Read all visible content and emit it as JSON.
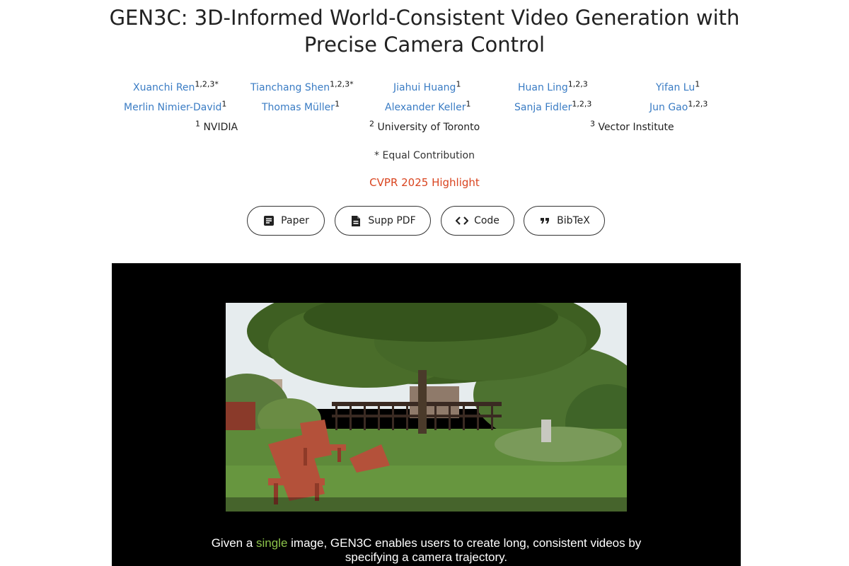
{
  "title_line1": "GEN3C: 3D-Informed World-Consistent Video Generation with",
  "title_line2": "Precise Camera Control",
  "authors": [
    {
      "name": "Xuanchi Ren",
      "sup": "1,2,3*"
    },
    {
      "name": "Tianchang Shen",
      "sup": "1,2,3*"
    },
    {
      "name": "Jiahui Huang",
      "sup": "1"
    },
    {
      "name": "Huan Ling",
      "sup": "1,2,3"
    },
    {
      "name": "Yifan Lu",
      "sup": "1"
    },
    {
      "name": "Merlin Nimier-David",
      "sup": "1"
    },
    {
      "name": "Thomas Müller",
      "sup": "1"
    },
    {
      "name": "Alexander Keller",
      "sup": "1"
    },
    {
      "name": "Sanja Fidler",
      "sup": "1,2,3"
    },
    {
      "name": "Jun Gao",
      "sup": "1,2,3"
    }
  ],
  "affiliations": [
    {
      "num": "1",
      "name": "NVIDIA"
    },
    {
      "num": "2",
      "name": "University of Toronto"
    },
    {
      "num": "3",
      "name": "Vector Institute"
    }
  ],
  "equal_contribution": "* Equal Contribution",
  "venue": "CVPR 2025 Highlight",
  "buttons": {
    "paper": "Paper",
    "supp": "Supp PDF",
    "code": "Code",
    "bibtex": "BibTeX"
  },
  "icons": {
    "paper": "paper-icon",
    "supp": "file-icon",
    "code": "code-icon",
    "bibtex": "quote-icon"
  },
  "caption": {
    "part1": "Given a ",
    "highlight": "single",
    "part2": " image, GEN3C enables users to create long, consistent videos by",
    "line2": "specifying a camera trajectory."
  },
  "colors": {
    "author_link": "#3a7cc4",
    "venue": "#d9441f",
    "caption_highlight": "#8bc34a",
    "video_bg": "#000000"
  }
}
